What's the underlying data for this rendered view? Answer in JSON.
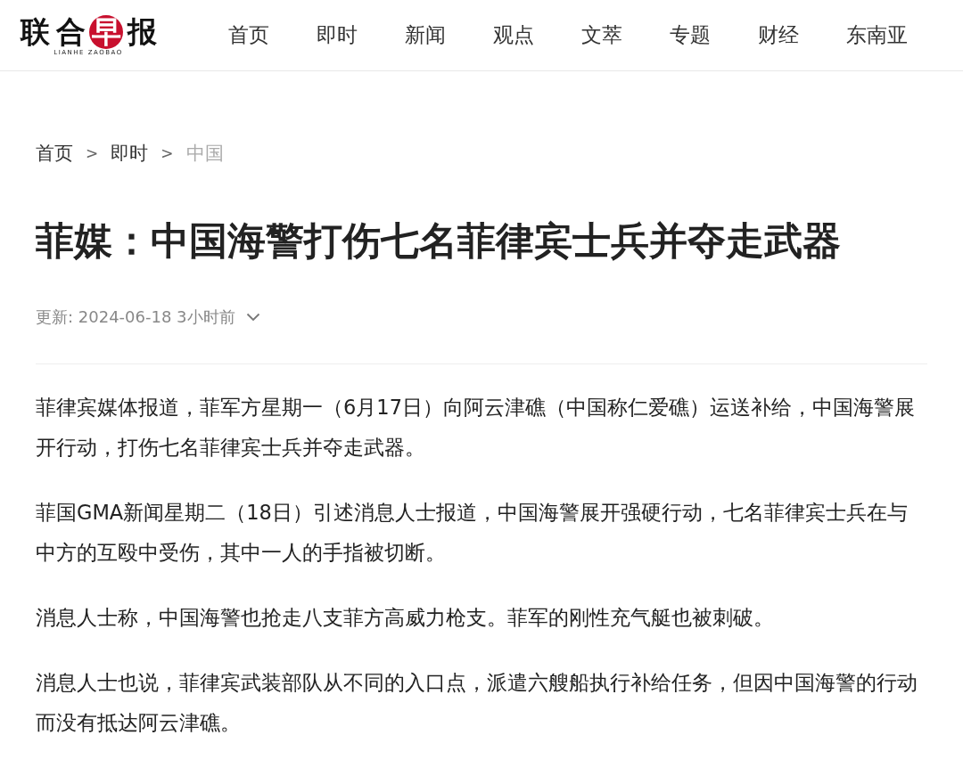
{
  "header": {
    "logo": {
      "chars": [
        {
          "char": "联",
          "highlighted": false
        },
        {
          "char": "合",
          "highlighted": false
        },
        {
          "char": "早",
          "highlighted": true
        },
        {
          "char": "报",
          "highlighted": false
        }
      ],
      "subtitle": "LIANHE ZAOBAO"
    },
    "nav": [
      {
        "label": "首页"
      },
      {
        "label": "即时"
      },
      {
        "label": "新闻"
      },
      {
        "label": "观点"
      },
      {
        "label": "文萃"
      },
      {
        "label": "专题"
      },
      {
        "label": "财经"
      },
      {
        "label": "东南亚"
      }
    ]
  },
  "breadcrumb": [
    {
      "label": "首页",
      "current": false
    },
    {
      "label": "即时",
      "current": false
    },
    {
      "label": "中国",
      "current": true
    }
  ],
  "breadcrumb_separator": ">",
  "article": {
    "title": "菲媒：中国海警打伤七名菲律宾士兵并夺走武器",
    "updated": "更新: 2024-06-18 3小时前",
    "paragraphs": [
      "菲律宾媒体报道，菲军方星期一（6月17日）向阿云津礁（中国称仁爱礁）运送补给，中国海警展开行动，打伤七名菲律宾士兵并夺走武器。",
      "菲国GMA新闻星期二（18日）引述消息人士报道，中国海警展开强硬行动，七名菲律宾士兵在与中方的互殴中受伤，其中一人的手指被切断。",
      "消息人士称，中国海警也抢走八支菲方高威力枪支。菲军的刚性充气艇也被刺破。",
      "消息人士也说，菲律宾武装部队从不同的入口点，派遣六艘船执行补给任务，但因中国海警的行动而没有抵达阿云津礁。"
    ]
  }
}
